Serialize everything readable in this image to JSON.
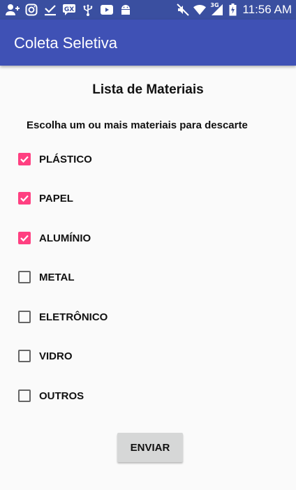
{
  "status_bar": {
    "time": "11:56 AM",
    "network_label": "3G",
    "left_icons": [
      "person-add-icon",
      "instagram-icon",
      "download-done-icon",
      "chat-icon",
      "usb-icon",
      "youtube-icon",
      "android-icon"
    ],
    "right_icons": [
      "mute-icon",
      "wifi-icon",
      "signal-icon",
      "battery-icon"
    ]
  },
  "app_bar": {
    "title": "Coleta Seletiva"
  },
  "content": {
    "title": "Lista de Materiais",
    "instruction": "Escolha um ou mais materiais para descarte",
    "materials": [
      {
        "label": "PLÁSTICO",
        "checked": true
      },
      {
        "label": "PAPEL",
        "checked": true
      },
      {
        "label": "ALUMÍNIO",
        "checked": true
      },
      {
        "label": "METAL",
        "checked": false
      },
      {
        "label": "ELETRÔNICO",
        "checked": false
      },
      {
        "label": "VIDRO",
        "checked": false
      },
      {
        "label": "OUTROS",
        "checked": false
      }
    ],
    "submit_label": "ENVIAR"
  },
  "colors": {
    "status_bar": "#3a4fa0",
    "app_bar": "#3f51b5",
    "accent": "#ff4081",
    "background": "#fafafa",
    "button": "#d6d7d7"
  }
}
